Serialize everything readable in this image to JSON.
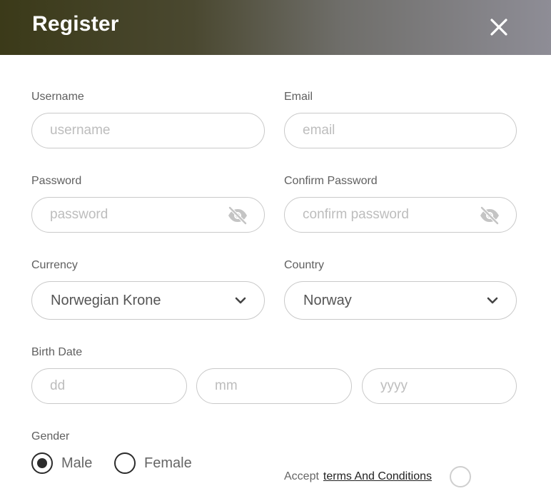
{
  "header": {
    "title": "Register",
    "close_icon": "close-icon"
  },
  "fields": {
    "username": {
      "label": "Username",
      "placeholder": "username",
      "value": ""
    },
    "email": {
      "label": "Email",
      "placeholder": "email",
      "value": ""
    },
    "password": {
      "label": "Password",
      "placeholder": "password",
      "value": "",
      "icon": "eye-slash-icon"
    },
    "confirm_password": {
      "label": "Confirm Password",
      "placeholder": "confirm password",
      "value": "",
      "icon": "eye-slash-icon"
    },
    "currency": {
      "label": "Currency",
      "value": "Norwegian Krone",
      "icon": "chevron-down-icon"
    },
    "country": {
      "label": "Country",
      "value": "Norway",
      "icon": "chevron-down-icon"
    },
    "birth_date": {
      "label": "Birth Date",
      "day_placeholder": "dd",
      "month_placeholder": "mm",
      "year_placeholder": "yyyy"
    }
  },
  "gender": {
    "label": "Gender",
    "options": [
      {
        "label": "Male",
        "selected": true
      },
      {
        "label": "Female",
        "selected": false
      }
    ]
  },
  "terms": {
    "prefix": "Accept",
    "link_text": "terms And Conditions",
    "accepted": false
  },
  "colors": {
    "header_start": "#3b3a19",
    "header_end": "#8e8d96",
    "border": "#c9c9c9",
    "radio": "#2b2b2b"
  }
}
